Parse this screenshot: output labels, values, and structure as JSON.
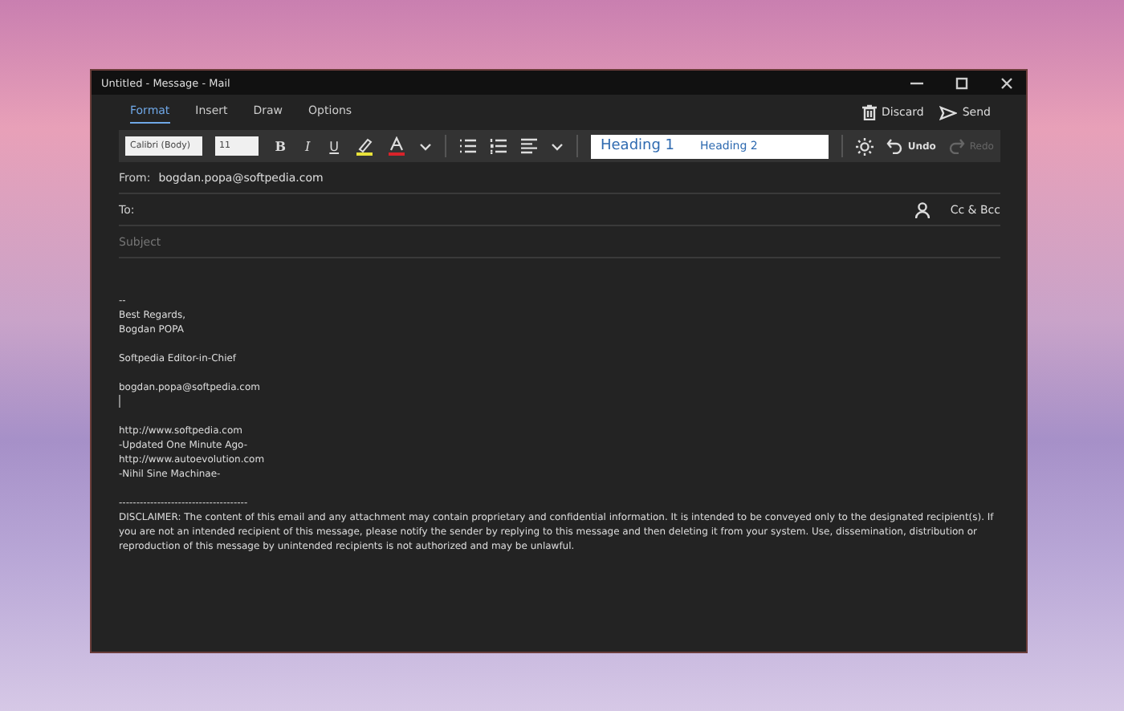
{
  "window": {
    "title": "Untitled - Message - Mail"
  },
  "tabs": [
    {
      "label": "Format",
      "selected": true
    },
    {
      "label": "Insert",
      "selected": false
    },
    {
      "label": "Draw",
      "selected": false
    },
    {
      "label": "Options",
      "selected": false
    }
  ],
  "actions": [
    {
      "kind": "discard",
      "label": "Discard"
    },
    {
      "kind": "send",
      "label": "Send"
    }
  ],
  "toolbar": {
    "font": "Calibri (Body)",
    "size": "11",
    "bold": "B",
    "italic": "I",
    "underline": "U",
    "styles": [
      {
        "label": "Heading 1",
        "kind": "h1"
      },
      {
        "label": "Heading 2",
        "kind": "h2"
      }
    ],
    "undo": {
      "label": "Undo",
      "disabled": false
    },
    "redo": {
      "label": "Redo",
      "disabled": true
    }
  },
  "header": {
    "from_label": "From:",
    "from": "bogdan.popa@softpedia.com",
    "to_label": "To:",
    "cc": "Cc & Bcc",
    "subject_placeholder": "Subject"
  },
  "body": [
    {
      "kind": "text",
      "text": "--"
    },
    {
      "kind": "text",
      "text": "Best Regards,"
    },
    {
      "kind": "text",
      "text": "Bogdan POPA"
    },
    {
      "kind": "blank"
    },
    {
      "kind": "text",
      "text": "Softpedia Editor-in-Chief"
    },
    {
      "kind": "blank"
    },
    {
      "kind": "text",
      "text": "bogdan.popa@softpedia.com"
    },
    {
      "kind": "cursor"
    },
    {
      "kind": "blank"
    },
    {
      "kind": "text",
      "text": "http://www.softpedia.com"
    },
    {
      "kind": "text",
      "text": "-Updated One Minute Ago-"
    },
    {
      "kind": "text",
      "text": "http://www.autoevolution.com"
    },
    {
      "kind": "text",
      "text": "-Nihil Sine Machinae-"
    },
    {
      "kind": "blank"
    },
    {
      "kind": "text",
      "text": "-------------------------------------"
    },
    {
      "kind": "para",
      "text": "DISCLAIMER: The content of this email and any attachment may contain proprietary and confidential information. It is intended to be conveyed only to the designated recipient(s). If you are not an intended recipient of this message, please notify the sender by replying to this message and then deleting it from your system. Use, dissemination, distribution or reproduction of this message by unintended recipients is not authorized and may be unlawful."
    }
  ]
}
